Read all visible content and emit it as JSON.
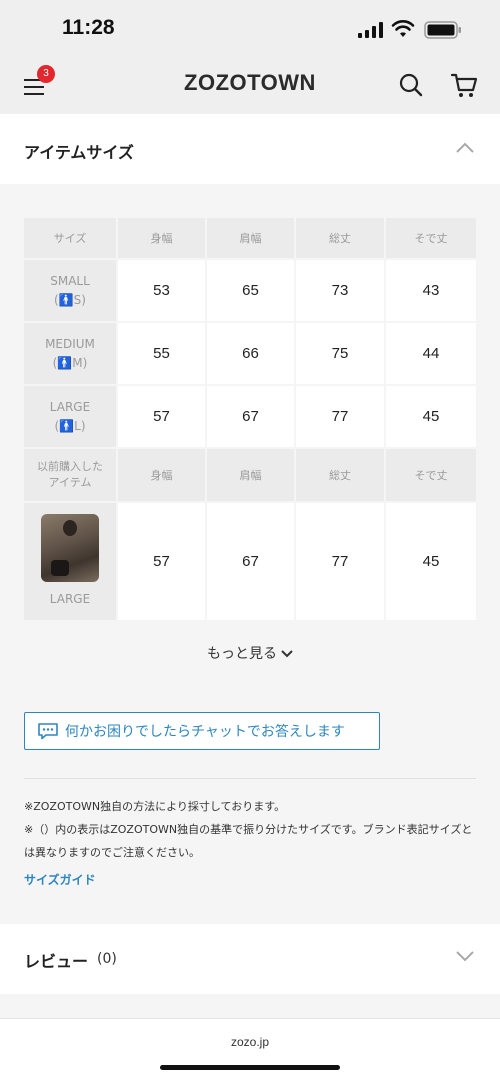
{
  "status": {
    "time": "11:28"
  },
  "header": {
    "logo": "ZOZOTOWN",
    "menu_badge": "3"
  },
  "item_size": {
    "title": "アイテムサイズ",
    "headers": [
      "サイズ",
      "身幅",
      "肩幅",
      "総丈",
      "そで丈"
    ],
    "rows": [
      {
        "label": "SMALL",
        "tag_open": "(",
        "tag": "S",
        "tag_close": ")",
        "values": [
          "53",
          "65",
          "73",
          "43"
        ]
      },
      {
        "label": "MEDIUM",
        "tag_open": "(",
        "tag": "M",
        "tag_close": ")",
        "values": [
          "55",
          "66",
          "75",
          "44"
        ]
      },
      {
        "label": "LARGE",
        "tag_open": "(",
        "tag": "L",
        "tag_close": ")",
        "values": [
          "57",
          "67",
          "77",
          "45"
        ]
      }
    ],
    "previous_header": {
      "label_line1": "以前購入した",
      "label_line2": "アイテム",
      "cols": [
        "身幅",
        "肩幅",
        "総丈",
        "そで丈"
      ]
    },
    "previous_row": {
      "size": "LARGE",
      "values": [
        "57",
        "67",
        "77",
        "45"
      ]
    },
    "more_label": "もっと見る"
  },
  "chat": {
    "label": "何かお困りでしたらチャットでお答えします"
  },
  "notes": {
    "line1": "※ZOZOTOWN独自の方法により採寸しております。",
    "line2": "※（）内の表示はZOZOTOWN独自の基準で振り分けたサイズです。ブランド表記サイズとは異なりますのでご注意ください。"
  },
  "size_guide": "サイズガイド",
  "review": {
    "title": "レビュー",
    "count": "(0)"
  },
  "bottom": {
    "url": "zozo.jp"
  },
  "colors": {
    "accent": "#2e86c1",
    "badge": "#e2272e",
    "size_icon": "#d8384b"
  },
  "icons": [
    "menu-icon",
    "search-icon",
    "cart-icon",
    "chevron-up-icon",
    "chevron-down-icon",
    "chat-icon",
    "person-icon"
  ]
}
